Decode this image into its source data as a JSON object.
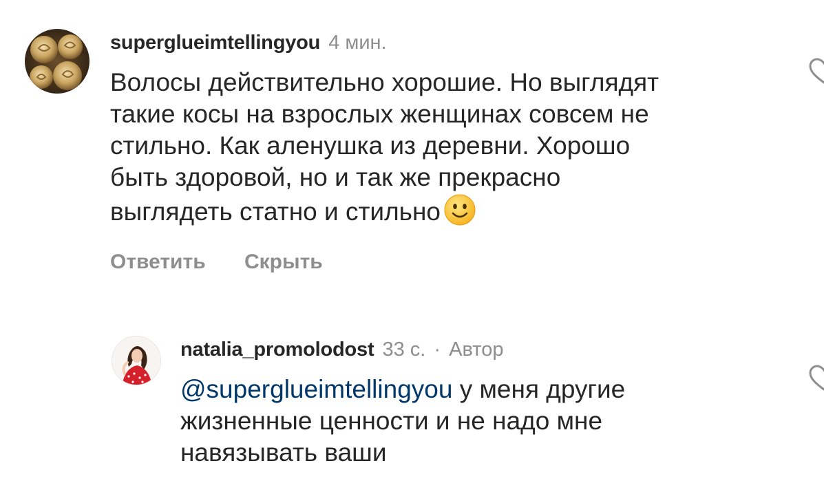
{
  "comments": [
    {
      "username": "superglueimtellingyou",
      "time": "4 мин.",
      "lines": [
        "Волосы действительно хорошие. Но выглядят",
        "такие косы на взрослых женщинах совсем не",
        "стильно. Как аленушка из деревни. Хорошо",
        "быть здоровой, но и так же прекрасно",
        "выглядеть статно и стильно"
      ],
      "emoji": "slightly-smiling-face",
      "actions": {
        "reply": "Ответить",
        "hide": "Скрыть"
      }
    },
    {
      "username": "natalia_promolodost",
      "time": "33 с.",
      "separator": "·",
      "author_label": "Автор",
      "mention": "@superglueimtellingyou",
      "lines": [
        "у меня другие",
        "жизненные ценности и не надо мне",
        "навязывать ваши"
      ]
    }
  ],
  "icons": {
    "avatar_1": "roses-avatar",
    "avatar_2": "woman-in-red-avatar",
    "like": "heart-icon"
  }
}
